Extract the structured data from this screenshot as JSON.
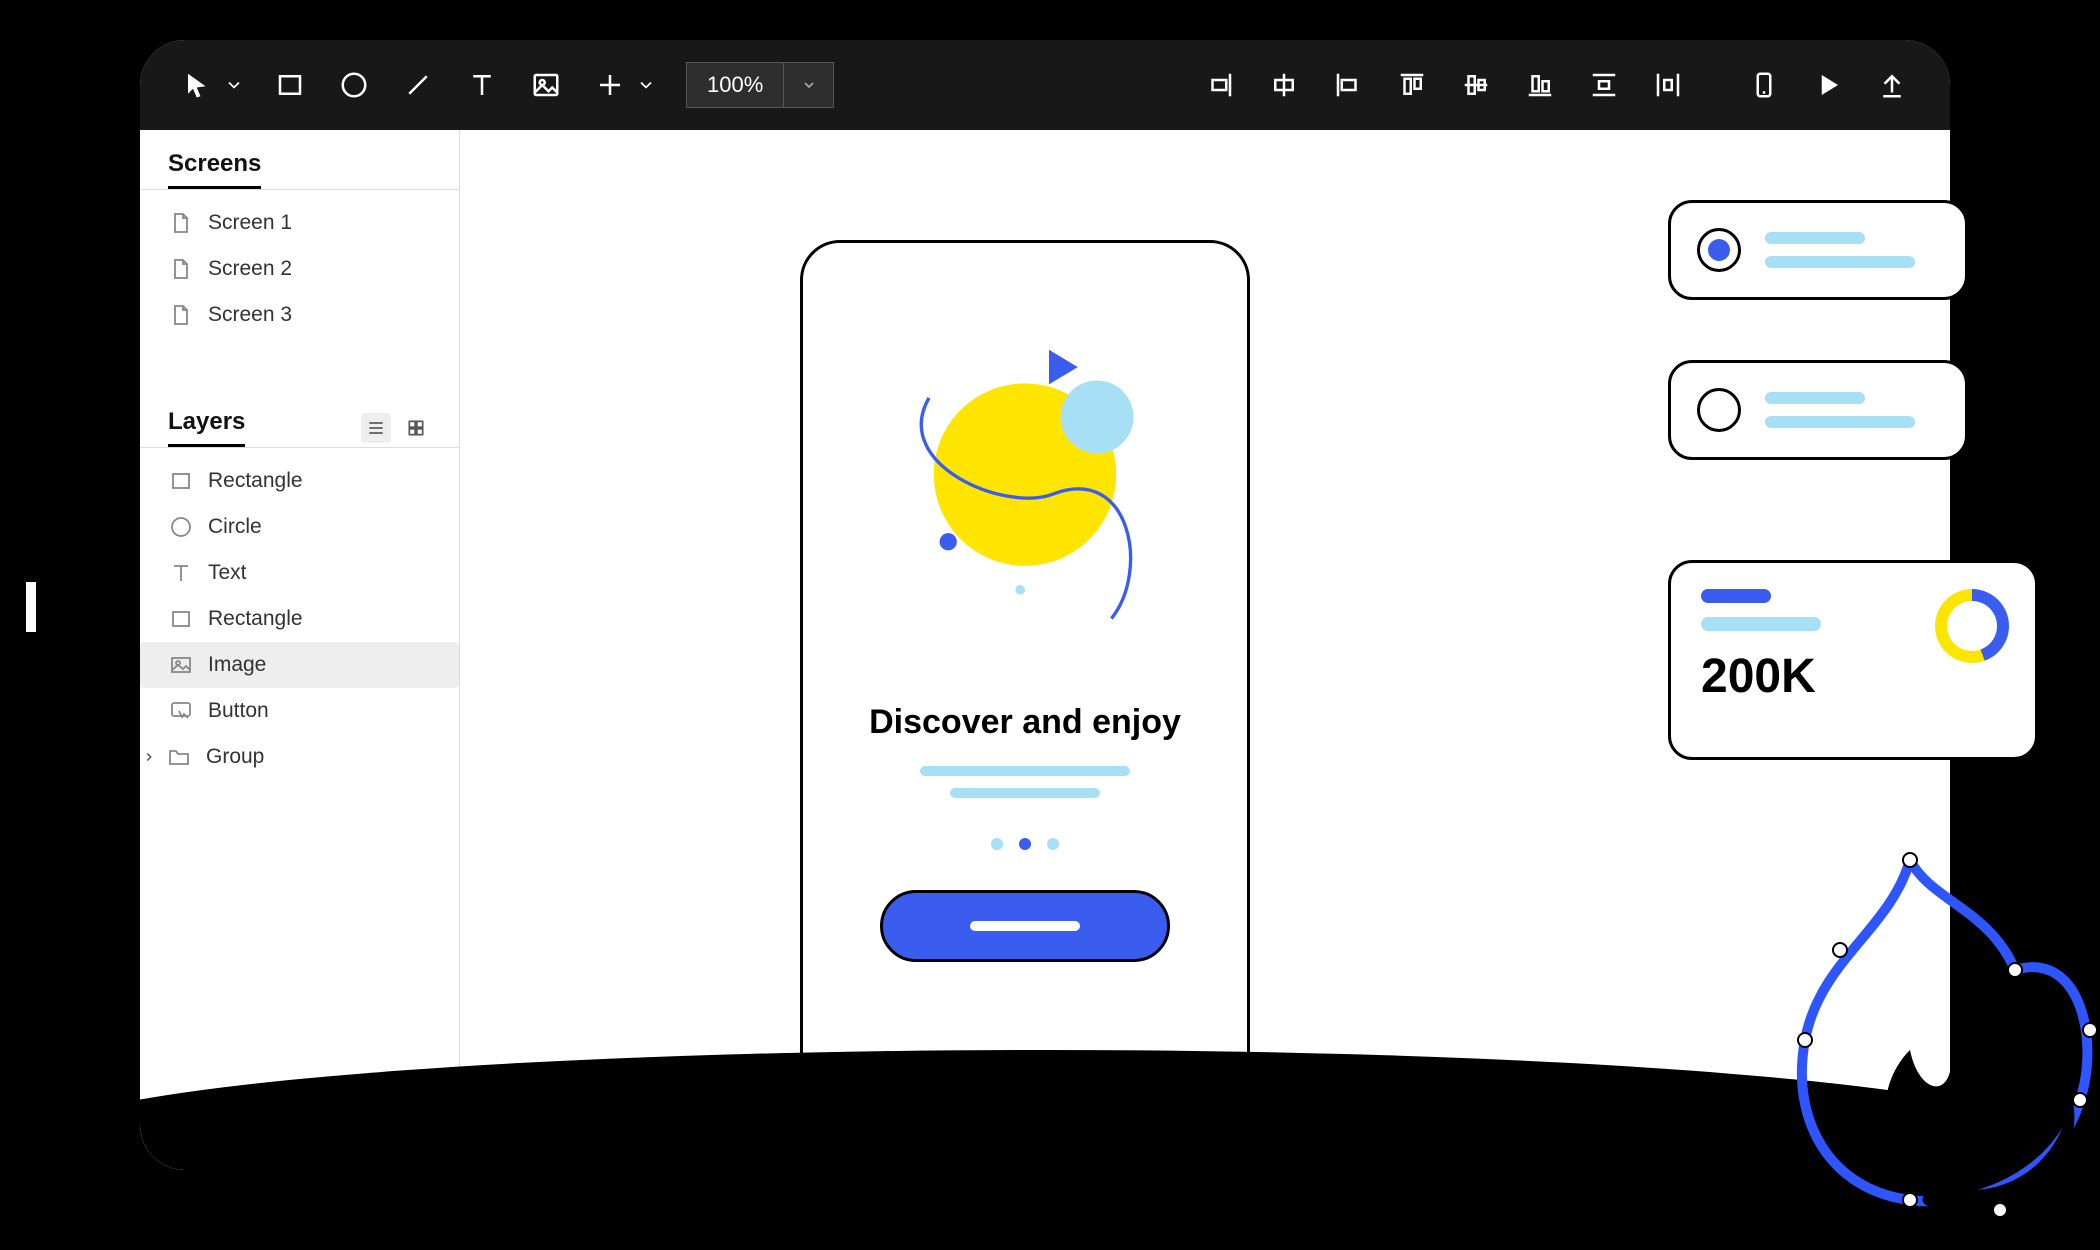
{
  "toolbar": {
    "zoom": "100%"
  },
  "sidebar": {
    "screens_title": "Screens",
    "screens": [
      {
        "label": "Screen 1"
      },
      {
        "label": "Screen 2"
      },
      {
        "label": "Screen 3"
      }
    ],
    "layers_title": "Layers",
    "layers": [
      {
        "label": "Rectangle",
        "icon": "rect"
      },
      {
        "label": "Circle",
        "icon": "circle"
      },
      {
        "label": "Text",
        "icon": "text"
      },
      {
        "label": "Rectangle",
        "icon": "rect"
      },
      {
        "label": "Image",
        "icon": "image",
        "selected": true
      },
      {
        "label": "Button",
        "icon": "button"
      },
      {
        "label": "Group",
        "icon": "folder",
        "hasChildren": true
      }
    ]
  },
  "canvas": {
    "phone_title": "Discover and enjoy"
  },
  "stat": {
    "value": "200K"
  }
}
